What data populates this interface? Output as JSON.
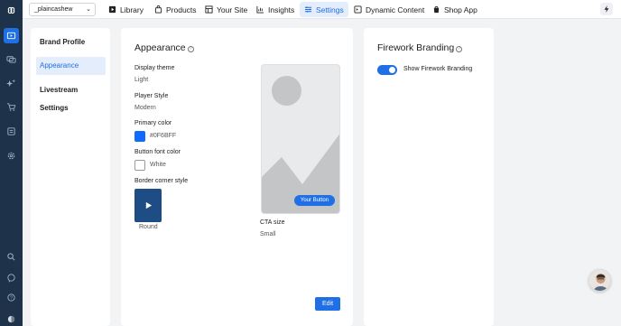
{
  "rail": {
    "icons": [
      "logo-icon",
      "video-icon",
      "chat-bubbles-icon",
      "sparkle-icon",
      "cart-icon",
      "calendar-icon",
      "gear-icon",
      "search-icon",
      "message-icon",
      "help-icon",
      "avatar"
    ]
  },
  "topbar": {
    "account_name": "_plaincashew",
    "nav": [
      {
        "label": "Library",
        "icon": "video-library-icon"
      },
      {
        "label": "Products",
        "icon": "bag-icon"
      },
      {
        "label": "Your Site",
        "icon": "site-icon"
      },
      {
        "label": "Insights",
        "icon": "chart-icon"
      },
      {
        "label": "Settings",
        "icon": "sliders-icon"
      },
      {
        "label": "Dynamic Content",
        "icon": "dynamic-content-icon"
      },
      {
        "label": "Shop App",
        "icon": "shop-icon"
      }
    ]
  },
  "sidebar": {
    "items": [
      "Brand Profile",
      "Appearance",
      "Livestream Settings"
    ]
  },
  "appearance": {
    "title": "Appearance",
    "display_theme_label": "Display theme",
    "display_theme_value": "Light",
    "player_style_label": "Player Style",
    "player_style_value": "Modern",
    "primary_color_label": "Primary color",
    "primary_color_value": "#0F6BFF",
    "button_font_color_label": "Button font color",
    "button_font_color_value": "White",
    "border_corner_label": "Border corner style",
    "border_corner_value": "Round",
    "preview_button": "Your Button",
    "cta_size_label": "CTA size",
    "cta_size_value": "Small",
    "edit_label": "Edit"
  },
  "branding": {
    "title": "Firework Branding",
    "toggle_label": "Show Firework Branding",
    "toggle_on": true
  },
  "colors": {
    "accent": "#1f6fe6",
    "rail": "#1e3349",
    "primary_swatch": "#0F6BFF",
    "corner_box": "#1e4d86"
  }
}
